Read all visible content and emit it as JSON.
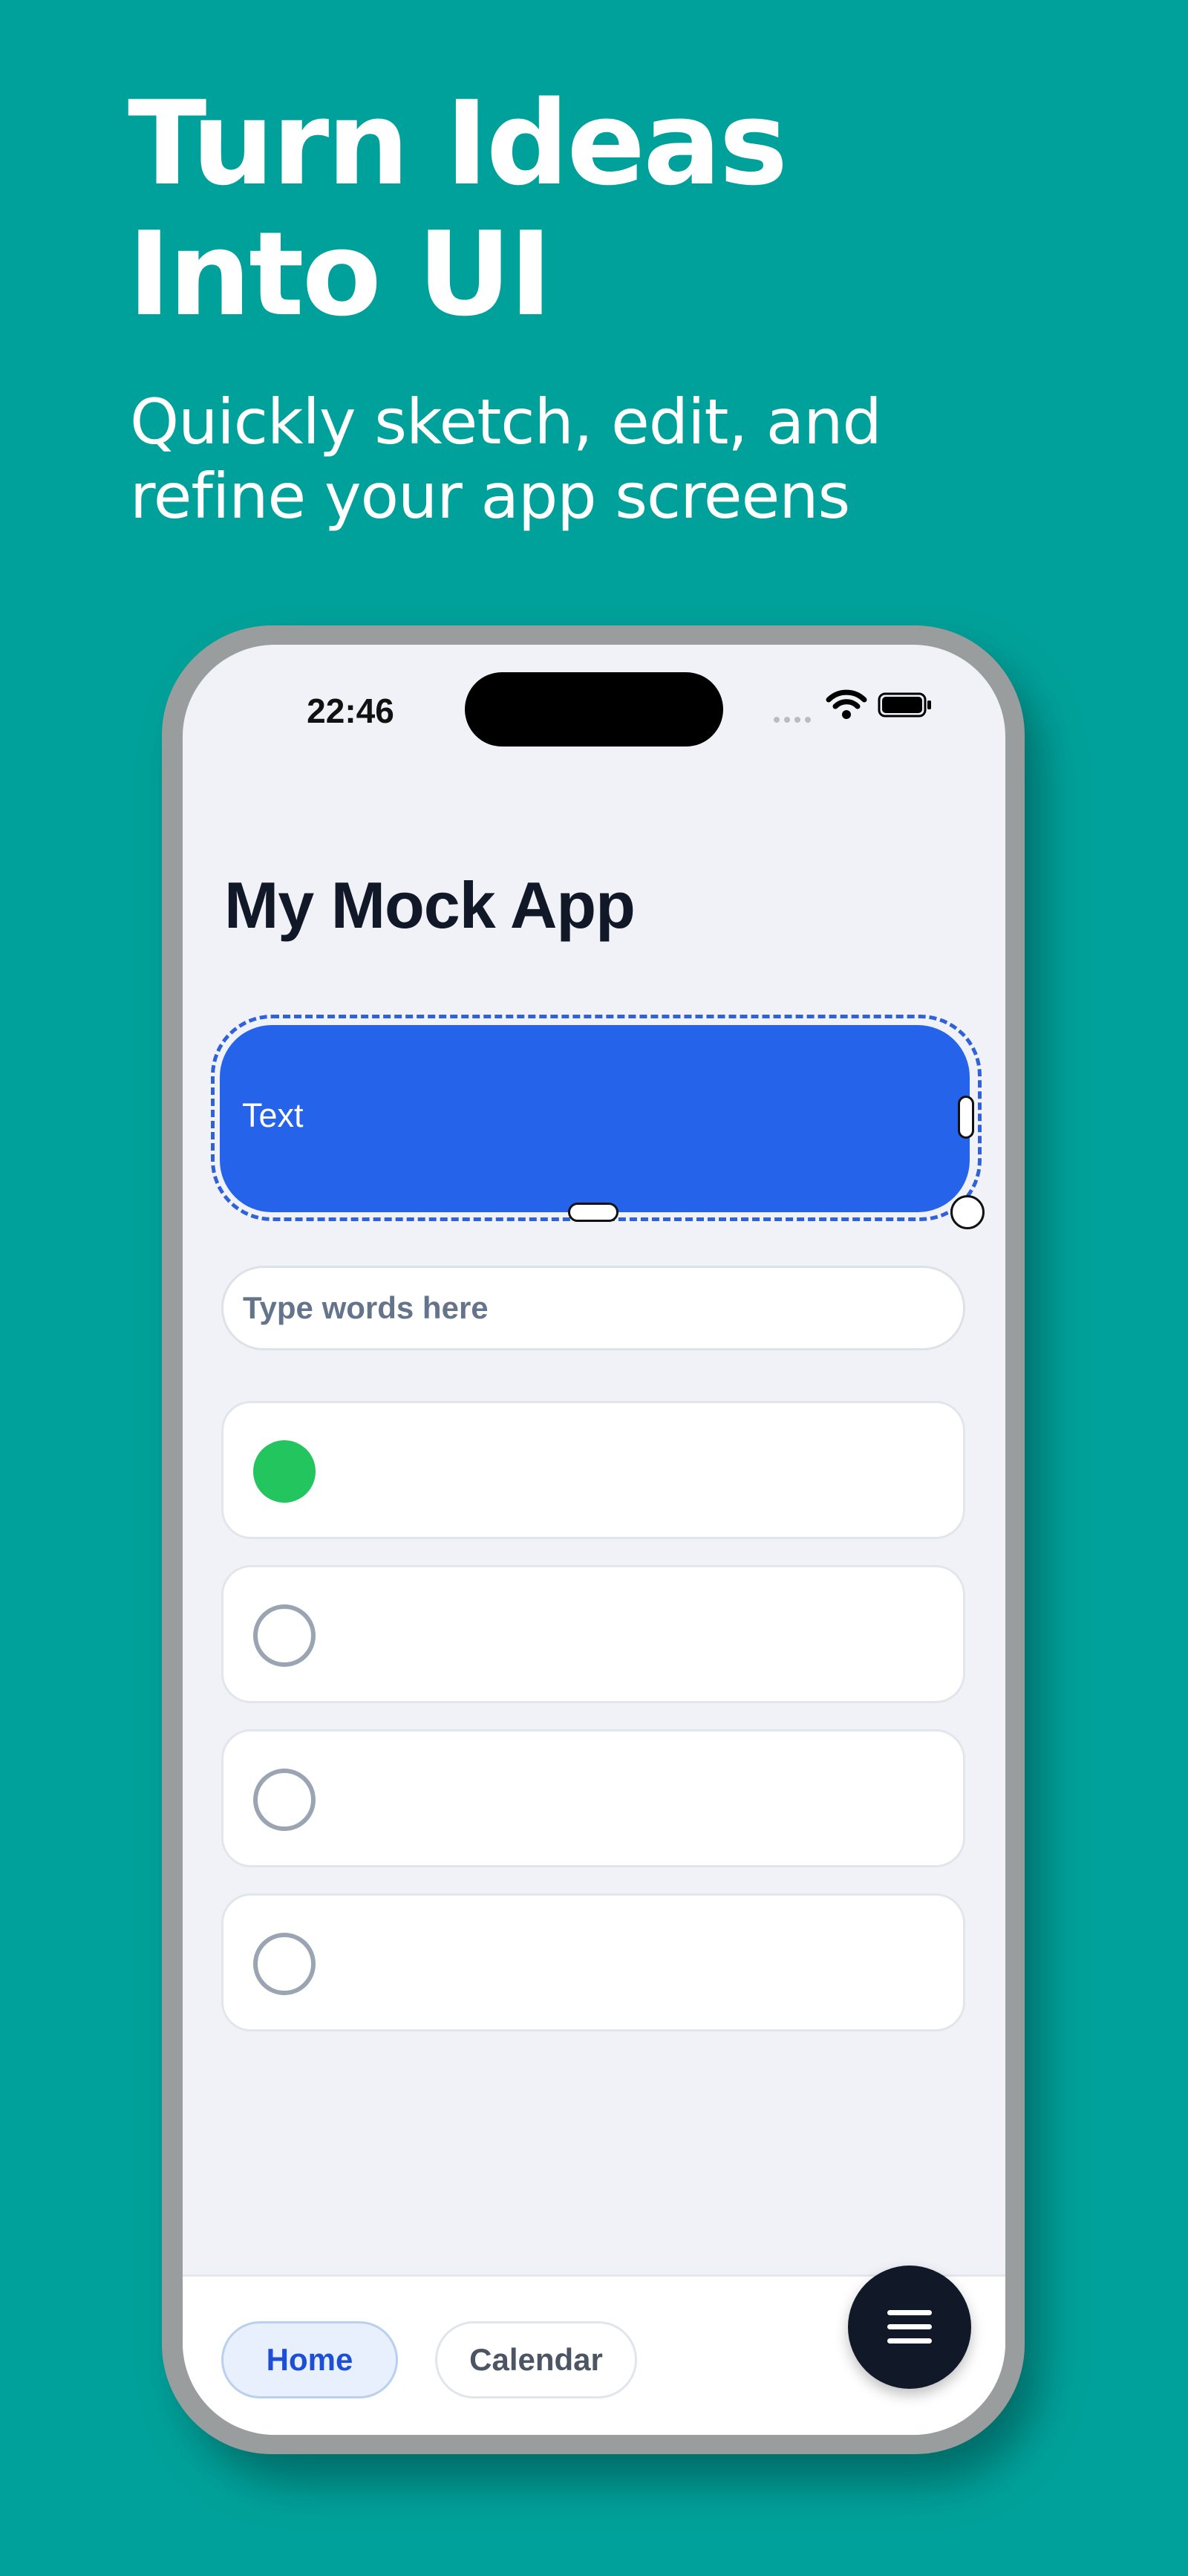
{
  "hero": {
    "headline_line1": "Turn Ideas",
    "headline_line2": "Into UI",
    "subhead_line1": "Quickly sketch, edit, and",
    "subhead_line2": "refine your app screens"
  },
  "status_bar": {
    "time": "22:46",
    "icons": [
      "signal-dots-icon",
      "wifi-icon",
      "battery-icon"
    ]
  },
  "app": {
    "title": "My Mock App",
    "selected_button": {
      "label": "Text",
      "color": "#2563eb",
      "selected": true
    },
    "input": {
      "placeholder": "Type words here",
      "value": ""
    },
    "list_items": [
      {
        "checked": true,
        "check_color": "#22c55e"
      },
      {
        "checked": false
      },
      {
        "checked": false
      },
      {
        "checked": false
      }
    ]
  },
  "bottom_nav": {
    "tabs": [
      {
        "label": "Home",
        "active": true
      },
      {
        "label": "Calendar",
        "active": false
      }
    ],
    "fab_icon": "menu-icon"
  },
  "colors": {
    "background": "#00a19a",
    "accent": "#2563eb",
    "success": "#22c55e",
    "dark": "#111827"
  }
}
